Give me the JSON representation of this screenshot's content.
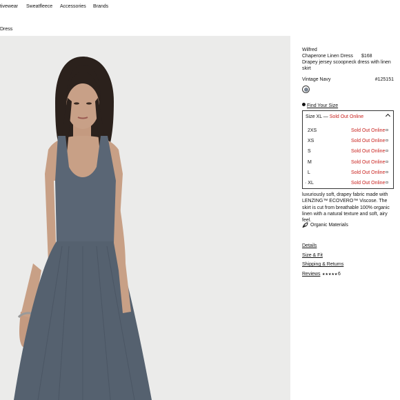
{
  "nav": {
    "items": [
      "tivewear",
      "Sweatfleece",
      "Accessories",
      "Brands"
    ]
  },
  "breadcrumb": "Dress",
  "product": {
    "brand": "Wilfred",
    "name": "Chaperone Linen Dress",
    "price": "$168",
    "subtitle": "Drapey jersey scoopneck dress with linen skirt",
    "color_name": "Vintage Navy",
    "sku": "#125151",
    "find_size": "Find Your Size",
    "size_prefix": "Size XL —",
    "size_status": "Sold Out Online",
    "sizes": [
      {
        "label": "2XS",
        "status": "Sold Out Online"
      },
      {
        "label": "XS",
        "status": "Sold Out Online"
      },
      {
        "label": "S",
        "status": "Sold Out Online"
      },
      {
        "label": "M",
        "status": "Sold Out Online"
      },
      {
        "label": "L",
        "status": "Sold Out Online"
      },
      {
        "label": "· XL",
        "status": "Sold Out Online"
      }
    ],
    "description": "luxuriously soft, drapey fabric made with LENZING™ ECOVERO™ Viscose. The skirt is cut from breathable 100% organic linen with a natural texture and soft, airy feel.",
    "organic_label": "Organic Materials",
    "links": {
      "details": "Details",
      "size_fit": "Size & Fit",
      "shipping": "Shipping & Returns",
      "reviews": "Reviews",
      "stars": "★★★★★",
      "review_count": "6"
    }
  },
  "colors": {
    "sold_out": "#c8201c",
    "dress": "#5a6675",
    "photo_bg": "#ebebea"
  }
}
